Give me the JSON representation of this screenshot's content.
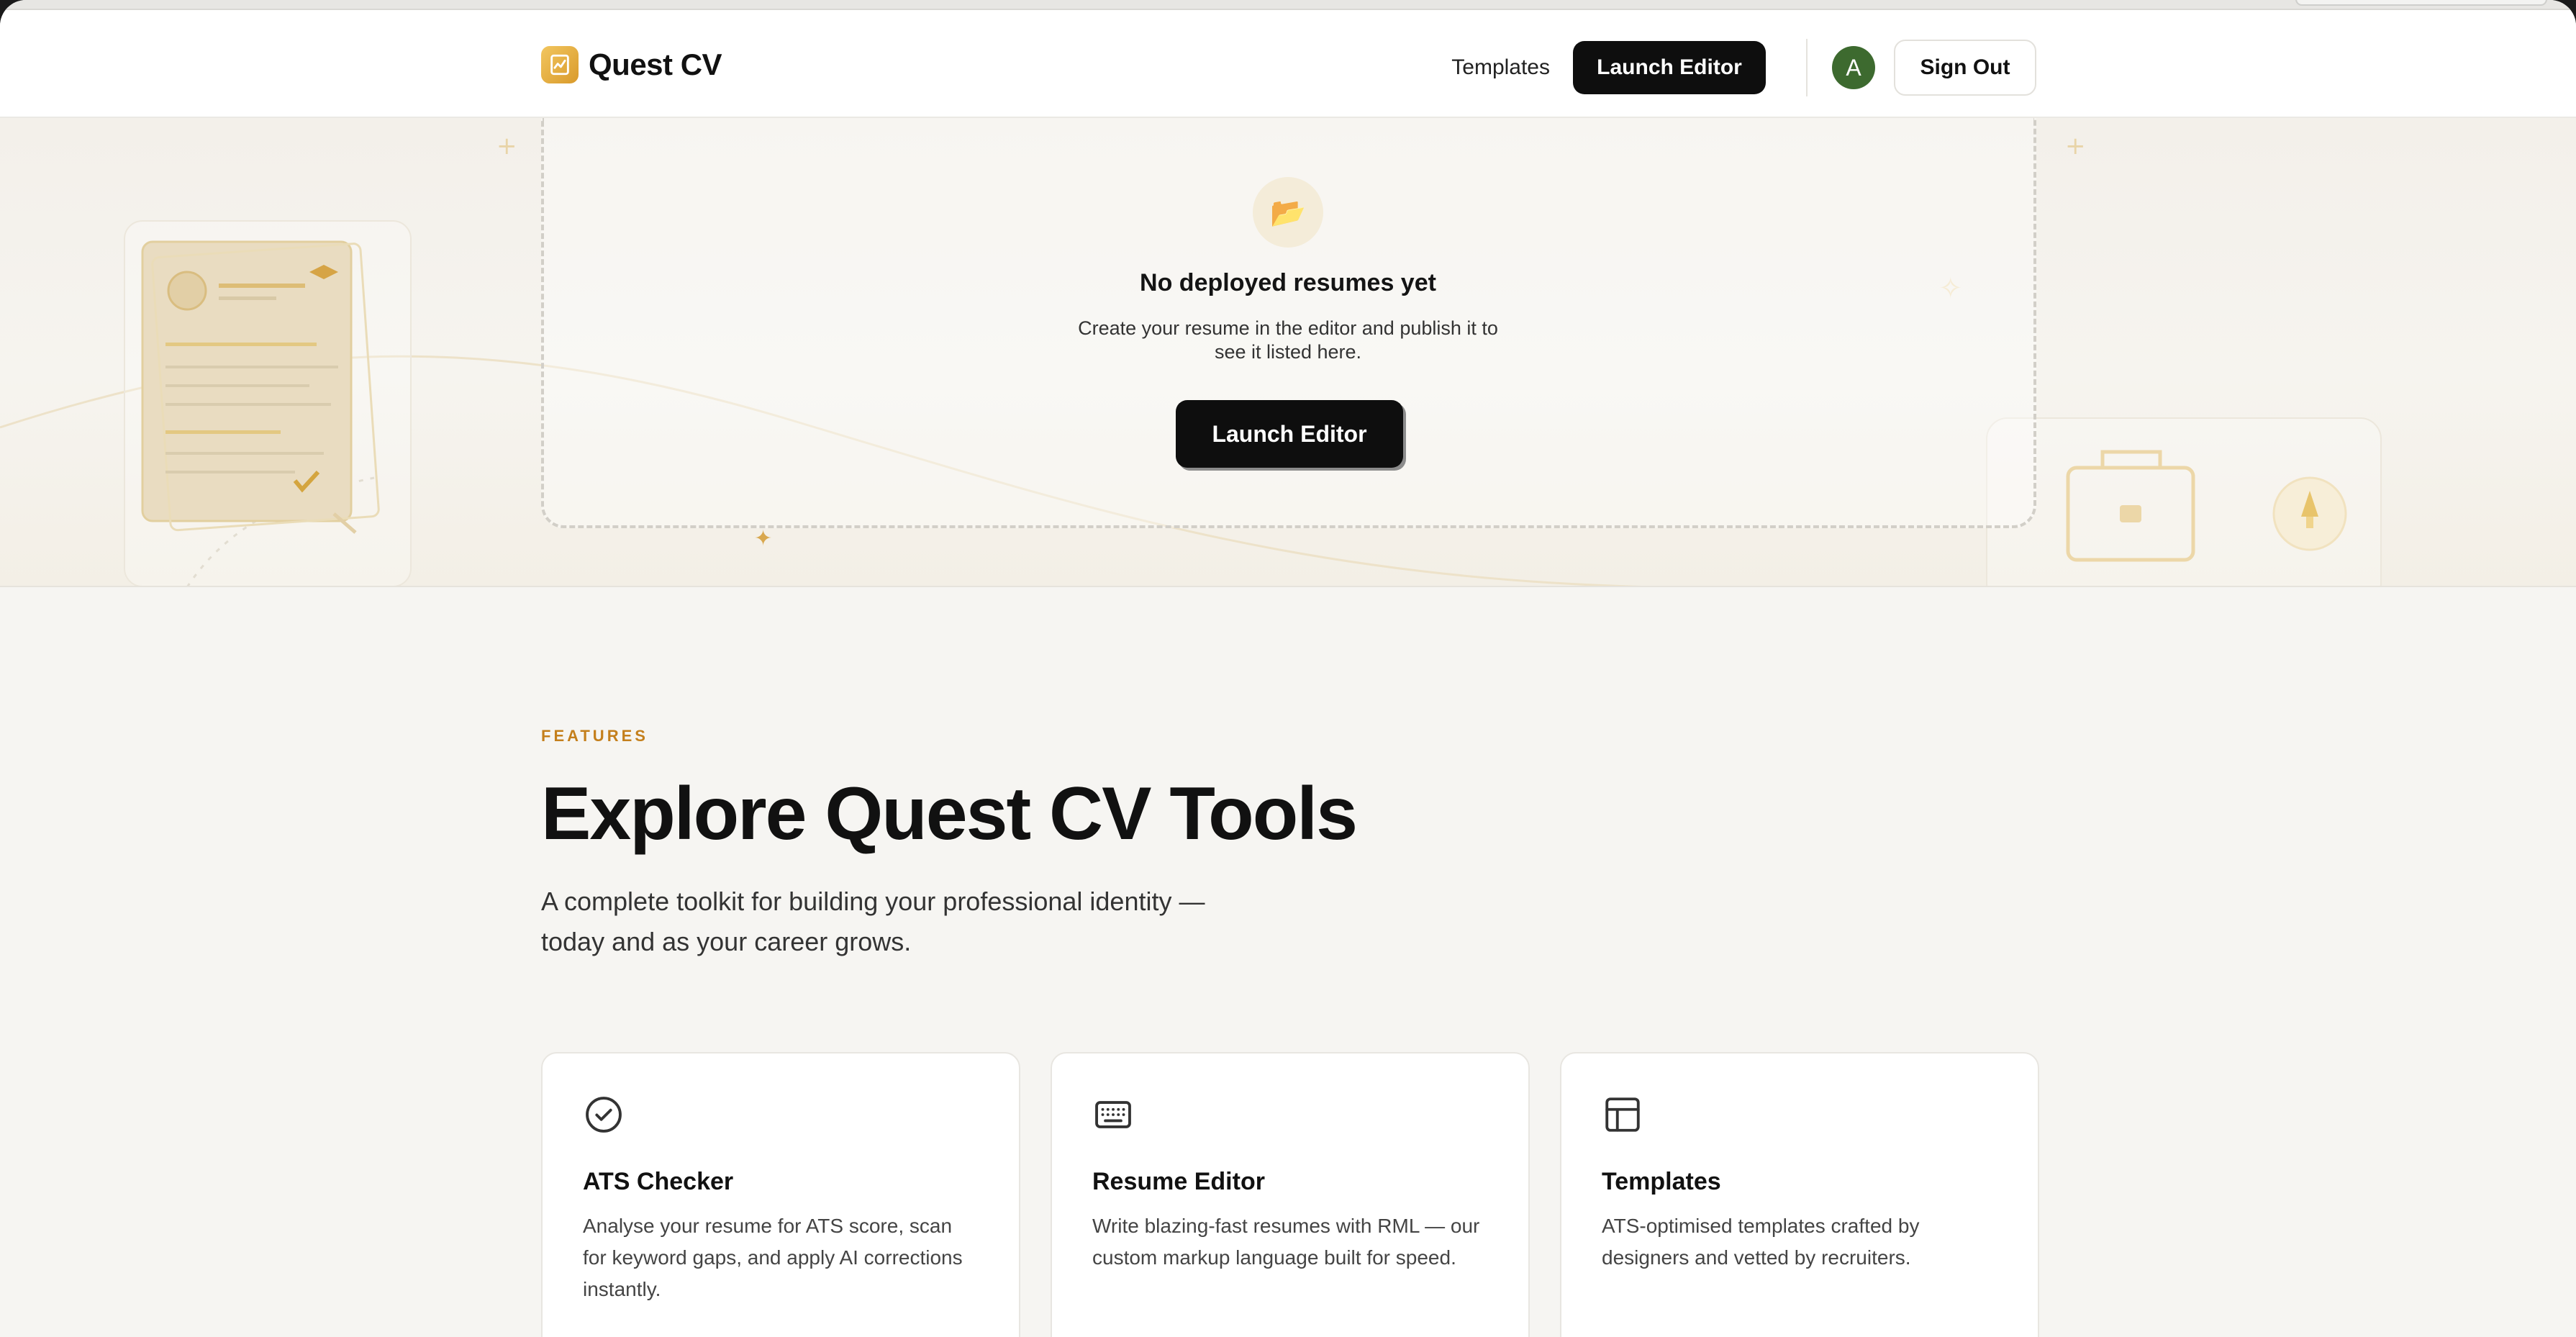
{
  "brand": {
    "name": "Quest CV",
    "accent": "#e0a73a"
  },
  "nav": {
    "templates_label": "Templates",
    "launch_editor_label": "Launch Editor",
    "avatar_initial": "A",
    "avatar_color": "#3d6a2f",
    "sign_out_label": "Sign Out"
  },
  "empty_state": {
    "icon": "folder-icon",
    "title": "No deployed resumes yet",
    "description": "Create your resume in the editor and publish it to see it listed here.",
    "button_label": "Launch Editor"
  },
  "features": {
    "eyebrow": "FEATURES",
    "title": "Explore Quest CV Tools",
    "subtitle": "A complete toolkit for building your professional identity — today and as your career grows.",
    "cards": [
      {
        "icon": "check-circle-icon",
        "title": "ATS Checker",
        "description": "Analyse your resume for ATS score, scan for keyword gaps, and apply AI corrections instantly."
      },
      {
        "icon": "keyboard-icon",
        "title": "Resume Editor",
        "description": "Write blazing-fast resumes with RML — our custom markup language built for speed."
      },
      {
        "icon": "layout-icon",
        "title": "Templates",
        "description": "ATS-optimised templates crafted by designers and vetted by recruiters."
      }
    ]
  }
}
